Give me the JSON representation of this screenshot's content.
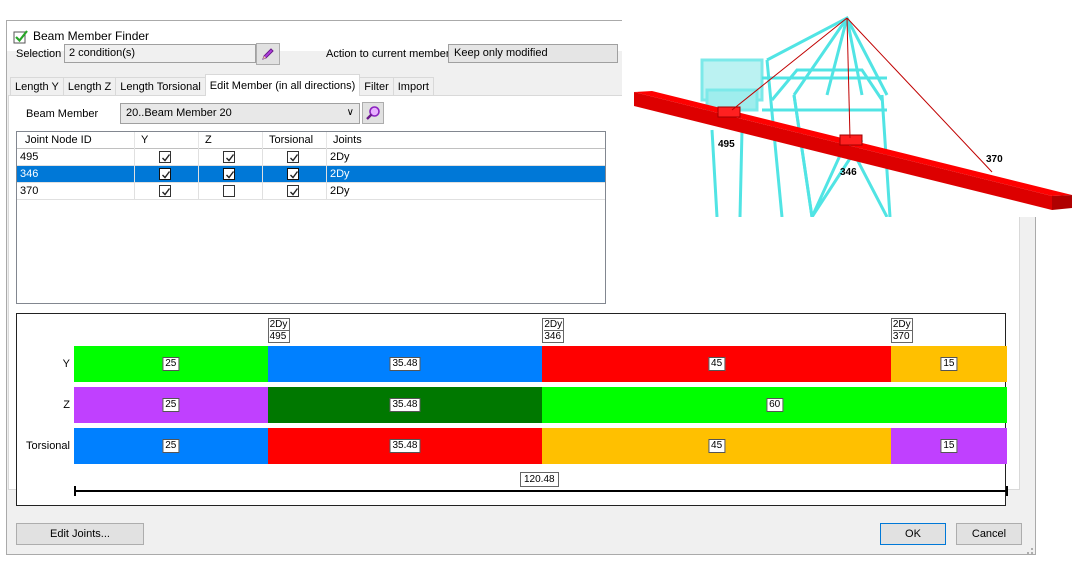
{
  "window": {
    "title": "Beam Member Finder",
    "colors": {
      "check": "#27a527",
      "accent": "#0078d7"
    }
  },
  "selection": {
    "label": "Selection",
    "value": "2 condition(s)",
    "edit_icon": "pencil-icon"
  },
  "action": {
    "label": "Action to current members",
    "value": "Keep only modified"
  },
  "tabs": [
    {
      "label": "Length Y",
      "active": false
    },
    {
      "label": "Length Z",
      "active": false
    },
    {
      "label": "Length Torsional",
      "active": false
    },
    {
      "label": "Edit Member (in all directions)",
      "active": true
    },
    {
      "label": "Filter",
      "active": false
    },
    {
      "label": "Import",
      "active": false
    }
  ],
  "beam_member": {
    "label": "Beam Member",
    "value": "20..Beam Member 20",
    "search_icon": "magnifier-icon"
  },
  "grid": {
    "columns": [
      "Joint Node ID",
      "Y",
      "Z",
      "Torsional",
      "Joints"
    ],
    "rows": [
      {
        "id": "495",
        "y": true,
        "z": true,
        "torsional": true,
        "joints": "2Dy",
        "selected": false
      },
      {
        "id": "346",
        "y": true,
        "z": true,
        "torsional": true,
        "joints": "2Dy",
        "selected": true
      },
      {
        "id": "370",
        "y": true,
        "z": false,
        "torsional": true,
        "joints": "2Dy",
        "selected": false
      }
    ]
  },
  "segments": {
    "joint_labels": [
      {
        "type": "2Dy",
        "id": "495"
      },
      {
        "type": "2Dy",
        "id": "346"
      },
      {
        "type": "2Dy",
        "id": "370"
      }
    ],
    "rows": [
      {
        "label": "Y",
        "segments": [
          {
            "value": "25",
            "color": "#00ff00"
          },
          {
            "value": "35.48",
            "color": "#0080ff"
          },
          {
            "value": "45",
            "color": "#ff0000"
          },
          {
            "value": "15",
            "color": "#ffc000"
          }
        ]
      },
      {
        "label": "Z",
        "segments": [
          {
            "value": "25",
            "color": "#c040ff"
          },
          {
            "value": "35.48",
            "color": "#007800"
          },
          {
            "value": "60",
            "color": "#00ff00"
          }
        ]
      },
      {
        "label": "Torsional",
        "segments": [
          {
            "value": "25",
            "color": "#0080ff"
          },
          {
            "value": "35.48",
            "color": "#ff0000"
          },
          {
            "value": "45",
            "color": "#ffc000"
          },
          {
            "value": "15",
            "color": "#c040ff"
          }
        ]
      }
    ],
    "total": "120.48"
  },
  "buttons": {
    "edit_joints": "Edit Joints...",
    "ok": "OK",
    "cancel": "Cancel"
  },
  "viewport": {
    "node_labels": [
      "495",
      "346",
      "370"
    ],
    "colors": {
      "beam": "#ff0000",
      "frame": "#33e0e0",
      "cable": "#c00000"
    }
  }
}
